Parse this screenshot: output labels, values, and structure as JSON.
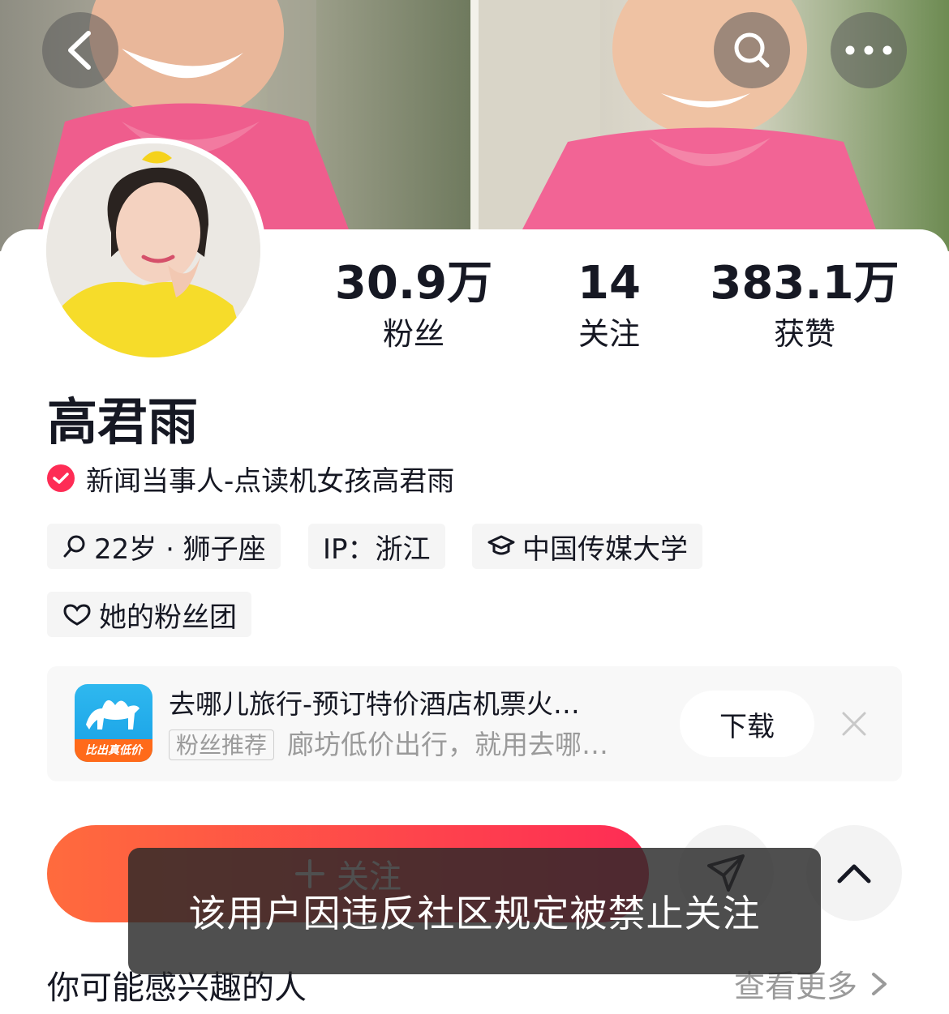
{
  "header": {
    "back_icon": "chevron-left-icon",
    "search_icon": "search-icon",
    "more_icon": "ellipsis-icon"
  },
  "profile": {
    "name": "高君雨",
    "verification": "新闻当事人-点读机女孩高君雨",
    "stats": [
      {
        "value": "30.9万",
        "label": "粉丝"
      },
      {
        "value": "14",
        "label": "关注"
      },
      {
        "value": "383.1万",
        "label": "获赞"
      }
    ],
    "tags": {
      "age": "22岁 · 狮子座",
      "ip": "IP：浙江",
      "school": "中国传媒大学",
      "fan_club": "她的粉丝团"
    }
  },
  "ad": {
    "app_badge": "比出真低价",
    "title": "去哪儿旅行-预订特价酒店机票火…",
    "label": "粉丝推荐",
    "description": "廊坊低价出行，就用去哪…",
    "download_label": "下载"
  },
  "actions": {
    "follow_label": "关注"
  },
  "toast": "该用户因违反社区规定被禁止关注",
  "suggestions": {
    "title": "你可能感兴趣的人",
    "more_label": "查看更多"
  },
  "colors": {
    "accent": "#fe2c55",
    "follow_gradient_start": "#ff6b3d",
    "tag_bg": "#f5f5f5"
  }
}
